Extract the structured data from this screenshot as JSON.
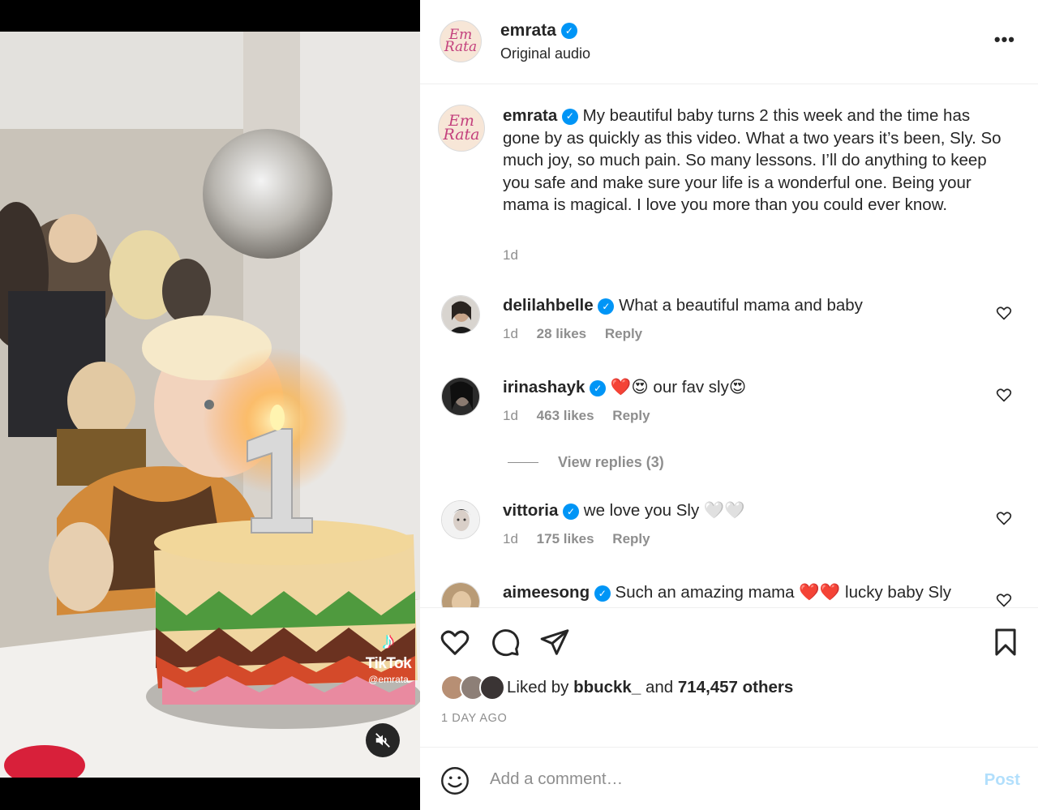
{
  "media": {
    "watermark_brand": "TikTok",
    "watermark_handle": "@emrata",
    "mute_icon": "speaker-muted-icon"
  },
  "header": {
    "username": "emrata",
    "verified": true,
    "subtitle": "Original audio",
    "more_icon": "more-horizontal-icon",
    "avatar_text_line1": "Em",
    "avatar_text_line2": "Rata"
  },
  "caption": {
    "username": "emrata",
    "text": "My beautiful baby turns 2 this week and the time has gone by as quickly as this video. What a two years it’s been, Sly. So much joy, so much pain. So many lessons. I’ll do anything to keep you safe and make sure your life is a wonderful one. Being your mama is magical. I love you more than you could ever know.",
    "time": "1d"
  },
  "comments": [
    {
      "username": "delilahbelle",
      "text": "What a beautiful mama and baby",
      "time": "1d",
      "likes": "28 likes",
      "reply": "Reply"
    },
    {
      "username": "irinashayk",
      "text": "❤️😍 our fav sly😍",
      "time": "1d",
      "likes": "463 likes",
      "reply": "Reply"
    },
    {
      "username": "vittoria",
      "text": "we love you Sly 🤍🤍",
      "time": "1d",
      "likes": "175 likes",
      "reply": "Reply"
    },
    {
      "username": "aimeesong",
      "text": "Such an amazing mama ❤️❤️ lucky baby Sly",
      "time": "",
      "likes": "",
      "reply": ""
    }
  ],
  "view_replies": "View replies (3)",
  "actions": {
    "like_icon": "heart-icon",
    "comment_icon": "comment-icon",
    "share_icon": "share-icon",
    "save_icon": "bookmark-icon"
  },
  "likes": {
    "prefix": "Liked by",
    "user": "bbuckk_",
    "middle": "and",
    "others": "714,457 others"
  },
  "timestamp": "1 DAY AGO",
  "comment_box": {
    "emoji_icon": "smiley-icon",
    "placeholder": "Add a comment…",
    "post_label": "Post"
  },
  "colors": {
    "verified": "#0095f6",
    "post_disabled": "#b2dffc",
    "secondary_text": "#8e8e8e"
  }
}
